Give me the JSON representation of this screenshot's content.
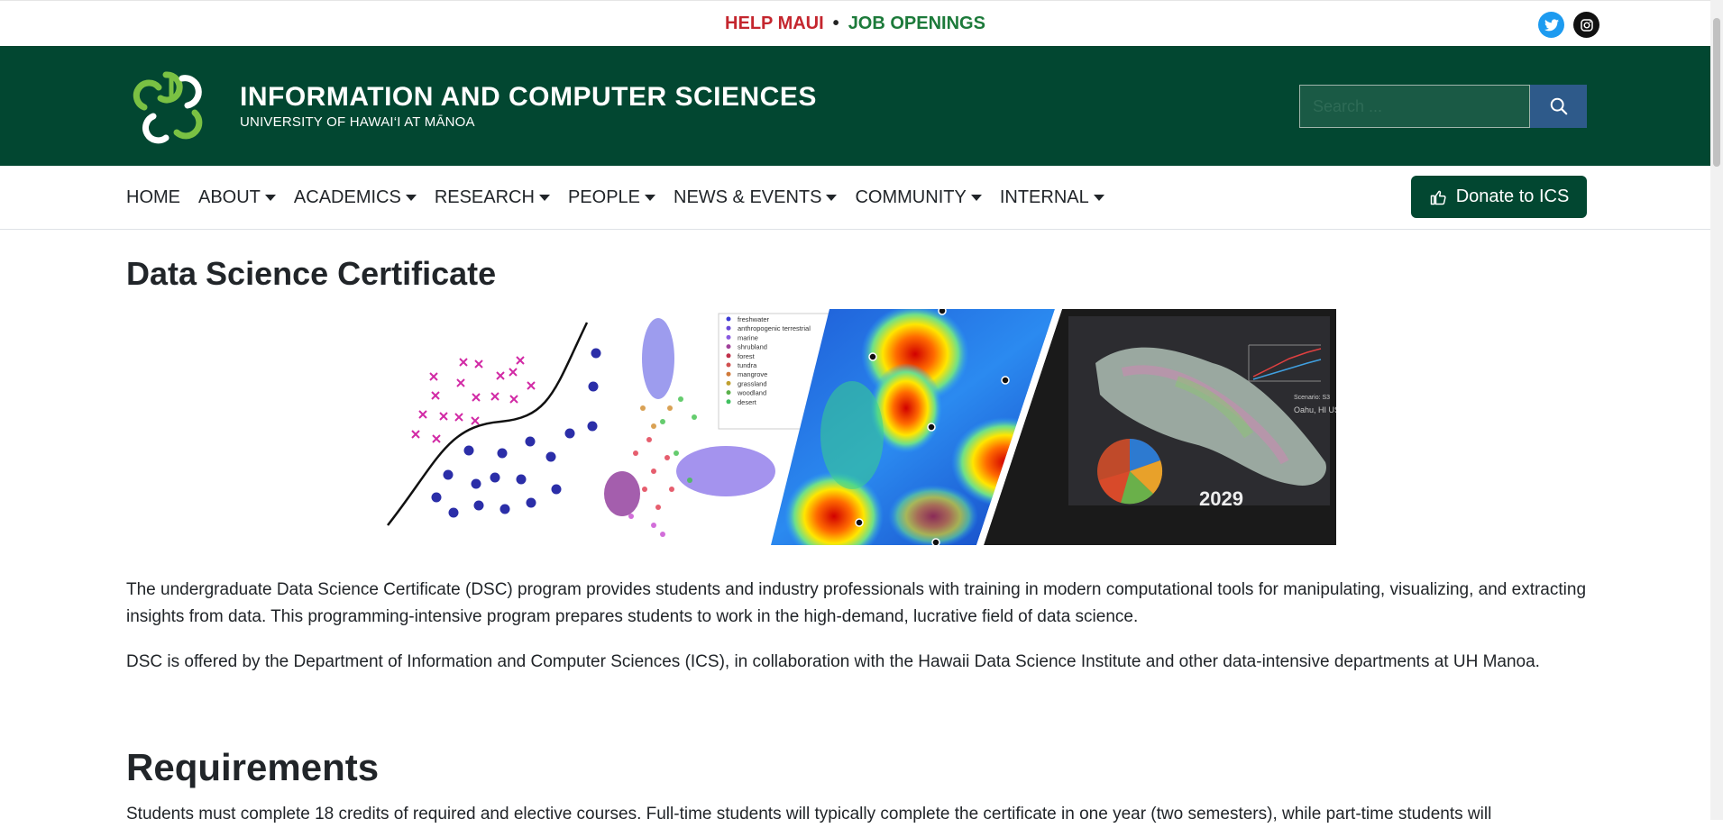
{
  "topbar": {
    "help_label": "HELP MAUI",
    "separator": "•",
    "jobs_label": "JOB OPENINGS",
    "twitter_icon": "twitter-icon",
    "instagram_icon": "instagram-icon"
  },
  "header": {
    "department": "INFORMATION AND COMPUTER SCIENCES",
    "university": "UNIVERSITY OF HAWAI‘I AT MĀNOA",
    "search_placeholder": "Search ...",
    "search_icon": "search-icon",
    "brand_color": "#024731"
  },
  "nav": {
    "items": [
      {
        "label": "HOME",
        "dropdown": false
      },
      {
        "label": "ABOUT",
        "dropdown": true
      },
      {
        "label": "ACADEMICS",
        "dropdown": true
      },
      {
        "label": "RESEARCH",
        "dropdown": true
      },
      {
        "label": "PEOPLE",
        "dropdown": true
      },
      {
        "label": "NEWS & EVENTS",
        "dropdown": true
      },
      {
        "label": "COMMUNITY",
        "dropdown": true
      },
      {
        "label": "INTERNAL",
        "dropdown": true
      }
    ],
    "donate_label": "Donate to ICS",
    "donate_icon": "thumbs-up-icon"
  },
  "main": {
    "title": "Data Science Certificate",
    "banner": {
      "legend": [
        "freshwater",
        "anthropogenic terrestrial",
        "marine",
        "shrubland",
        "forest",
        "tundra",
        "mangrove",
        "grassland",
        "woodland",
        "desert"
      ],
      "year": "2029",
      "map_label": "Oahu, HI USA",
      "scenario_label": "Scenario: S3"
    },
    "intro": "The undergraduate Data Science Certificate (DSC) program provides students and industry professionals with training in modern computational tools for manipulating, visualizing, and extracting insights from data. This programming-intensive program prepares students to work in the high-demand, lucrative field of data science.",
    "offered_by": "DSC is offered by the Department of Information and Computer Sciences (ICS), in collaboration with the Hawaii Data Science Institute and other data-intensive departments at UH Manoa.",
    "requirements_heading": "Requirements",
    "requirements_text": "Students must complete 18 credits of required and elective courses. Full-time students will typically complete the certificate in one year (two semesters), while part-time students will"
  }
}
